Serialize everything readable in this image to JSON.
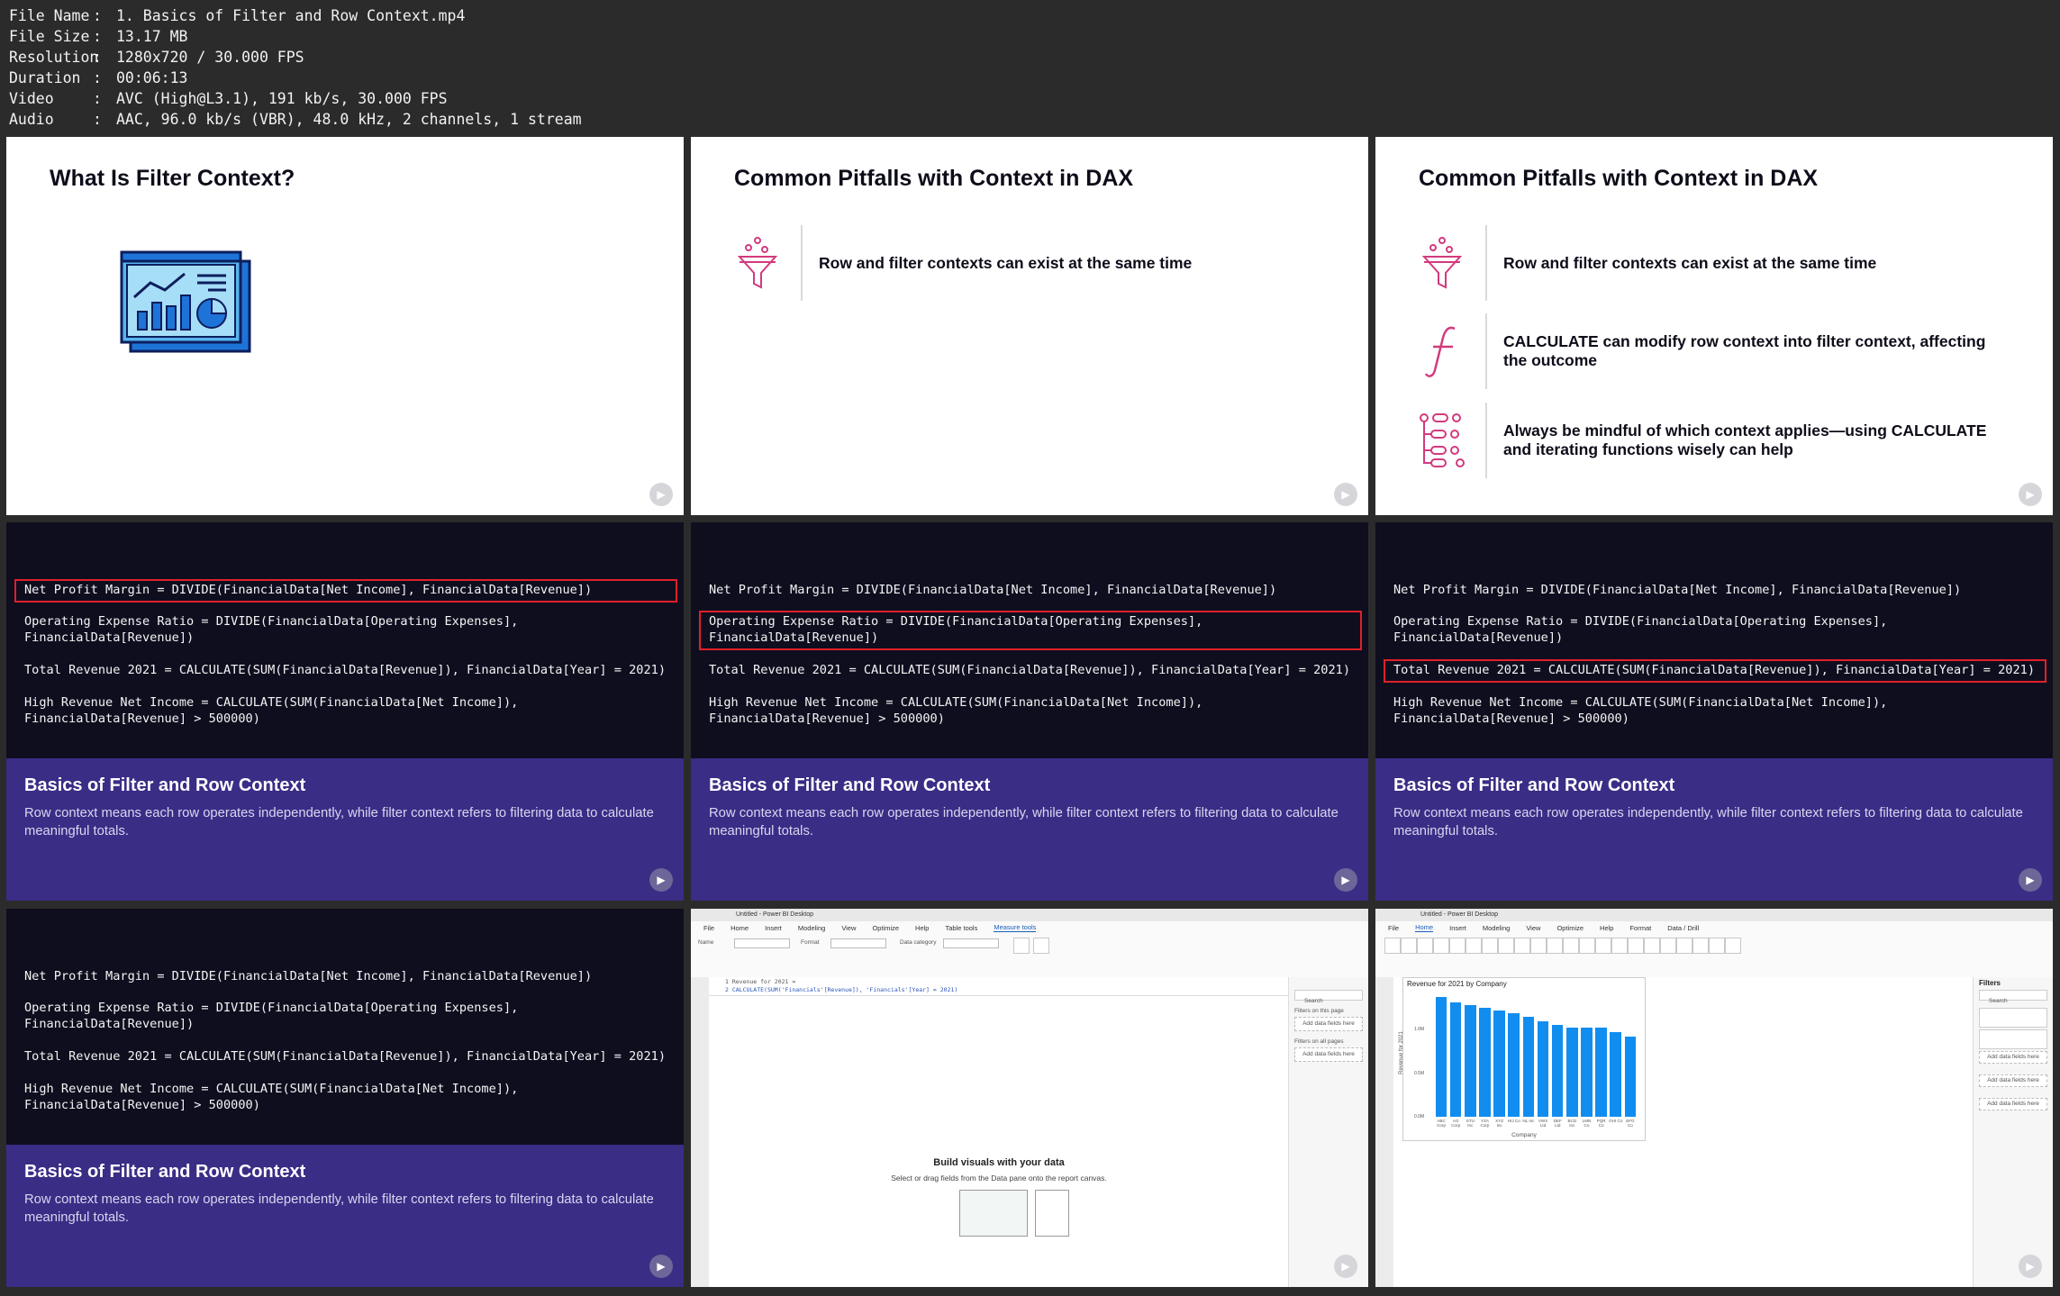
{
  "file_info": [
    {
      "key": "File Name",
      "value": "1. Basics of Filter and Row Context.mp4"
    },
    {
      "key": "File Size",
      "value": "13.17 MB"
    },
    {
      "key": "Resolution",
      "value": "1280x720 / 30.000 FPS"
    },
    {
      "key": "Duration",
      "value": "00:06:13"
    },
    {
      "key": "Video",
      "value": "AVC (High@L3.1), 191 kb/s, 30.000 FPS"
    },
    {
      "key": "Audio",
      "value": "AAC, 96.0 kb/s (VBR), 48.0 kHz, 2 channels, 1 stream"
    }
  ],
  "slide1": {
    "title": "What Is Filter Context?",
    "icon": "analytics-dashboard-icon"
  },
  "slide2": {
    "title": "Common Pitfalls with Context in DAX",
    "items": [
      {
        "text": "Row and filter contexts can exist at the same time",
        "icon": "funnel-icon"
      }
    ]
  },
  "slide3": {
    "title": "Common Pitfalls with Context in DAX",
    "items": [
      {
        "text": "Row and filter contexts can exist at the same time",
        "icon": "funnel-icon"
      },
      {
        "text": "CALCULATE can modify row context into filter context, affecting the outcome",
        "icon": "function-icon"
      },
      {
        "text": "Always be mindful of which context applies—using CALCULATE and iterating functions wisely can help",
        "icon": "flow-icon"
      }
    ]
  },
  "code": {
    "line1": "Net Profit Margin = DIVIDE(FinancialData[Net Income], FinancialData[Revenue])",
    "line2a": "Operating Expense Ratio = DIVIDE(FinancialData[Operating Expenses],",
    "line2b": "FinancialData[Revenue])",
    "line3": "Total Revenue 2021 = CALCULATE(SUM(FinancialData[Revenue]), FinancialData[Year] = 2021)",
    "line4a": "High Revenue Net Income = CALCULATE(SUM(FinancialData[Net Income]),",
    "line4b": "FinancialData[Revenue] > 500000)"
  },
  "caption": {
    "title": "Basics of Filter and Row Context",
    "desc": "Row context means each row operates independently, while filter context refers to filtering data to calculate meaningful totals."
  },
  "pbi_measure": {
    "window_title": "Untitled - Power BI Desktop",
    "menus": [
      "File",
      "Home",
      "Insert",
      "Modeling",
      "View",
      "Optimize",
      "Help",
      "Table tools",
      "Measure tools"
    ],
    "active_menu": "Measure tools",
    "formula_line1": "1  Revenue for 2021 =",
    "formula_line2": "2  CALCULATE(SUM('Financials'[Revenue]), 'Financials'[Year] = 2021)",
    "empty_title": "Build visuals with your data",
    "empty_sub": "Select or drag fields from the Data pane onto the report canvas.",
    "search": "Search",
    "filters_page": "Filters on this page",
    "filters_all": "Filters on all pages",
    "add_fields": "Add data fields here"
  },
  "pbi_chart": {
    "window_title": "Untitled - Power BI Desktop",
    "menus": [
      "File",
      "Home",
      "Insert",
      "Modeling",
      "View",
      "Optimize",
      "Help",
      "Format",
      "Data / Drill"
    ],
    "active_menu": "Home",
    "filters_title": "Filters",
    "search": "Search",
    "add_fields": "Add data fields here",
    "chart_data": {
      "type": "bar",
      "title": "Revenue for 2021 by Company",
      "xlabel": "Company",
      "ylabel": "Revenue for 2021",
      "yticks": [
        "0.0M",
        "0.5M",
        "1.0M"
      ],
      "categories": [
        "ABC Corp",
        "AG Corp",
        "STU Inc",
        "YZA Corp",
        "XYZ Inc",
        "HIJ Co",
        "NL Inc",
        "VWX Ltd",
        "DEF Ltd",
        "BCD Inc",
        "LMN Co",
        "PQR Co",
        "GHI Co",
        "EFG Co"
      ],
      "values": [
        1.38,
        1.32,
        1.28,
        1.25,
        1.22,
        1.19,
        1.15,
        1.1,
        1.06,
        1.03,
        1.03,
        1.03,
        0.97,
        0.92
      ],
      "ylim": [
        0,
        1.45
      ],
      "color": "#118df0"
    }
  }
}
